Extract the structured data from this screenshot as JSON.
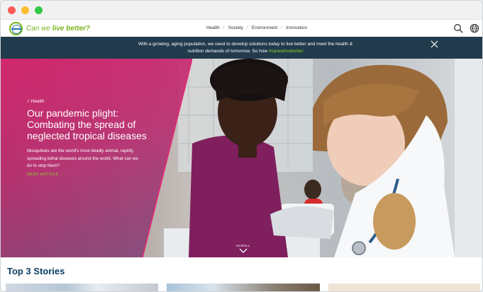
{
  "window": {
    "controls": [
      "close",
      "minimize",
      "zoom"
    ]
  },
  "header": {
    "logo_icon": "bayer-cross-logo",
    "tagline_prefix": "Can we ",
    "tagline_bold": "live better?",
    "nav": [
      {
        "label": "Health"
      },
      {
        "label": "Society"
      },
      {
        "label": "Environment"
      },
      {
        "label": "Innovation"
      }
    ],
    "separator": "/",
    "icons": [
      "search-icon",
      "globe-icon"
    ]
  },
  "banner": {
    "text": "With a growing, aging population, we need to develop solutions today to live better and meet the health & nutrition demands of tomorrow. So how",
    "hashtag": "#canwelivebetter",
    "close_icon": "close-icon",
    "background": "#213b4c"
  },
  "hero": {
    "category": "Health",
    "category_marker": "//",
    "title": "Our pandemic plight: Combating the spread of neglected tropical diseases",
    "summary": "Mosquitoes are the world's most deadly animal, rapidly spreading lethal diseases around the world. What can we do to stop them?",
    "cta": "READ ARTICLE →",
    "scroll_label": "SCROLL",
    "accent": "#d6206b",
    "cta_color": "#89d329"
  },
  "stories": {
    "title": "Top 3 Stories"
  }
}
